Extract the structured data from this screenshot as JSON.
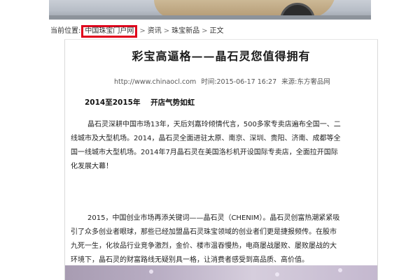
{
  "breadcrumb": {
    "prefix": "当前位置:",
    "items": [
      "中国珠宝门户网",
      "资讯",
      "珠宝新品",
      "正文"
    ],
    "separator": ">"
  },
  "article": {
    "title": "彩宝高逼格——晶石灵您值得拥有",
    "url": "http://www.chinaocl.com",
    "time_label": "时间:",
    "time": "2015-06-17 16:27",
    "source_label": "来源:",
    "source": "东方奢品网",
    "section_heading": "2014至2015年    开店气势如虹",
    "paragraph1_lines": [
      "晶石灵深耕中国市场13年，天后刘嘉玲倾情代言，500多家专卖店遍布全国一、二",
      "线城市及大型机场。2014，晶石灵全面进驻太原、南京、深圳、贵阳、济南、成都等全",
      "国一线城市大型机场。2014年7月晶石灵在美国洛杉机开设国际专卖店，全面拉开国际",
      "化发展大幕！"
    ],
    "paragraph2_lines": [
      "2015，中国创业市场再添关键词——晶石灵（CHENIM）。晶石灵创富热潮紧紧吸",
      "引了众多创业者眼球，那些已经加盟晶石灵珠宝领域的创业者们更是捷报频传。在股市",
      "九死一生，化妆品行业竞争激烈，金价、楼市温吞慢热，电商屡战屡败、屡败屡战的大",
      "环境下，晶石灵的财富路线无疑别具一格，让消费者感受到高品质、高价值。"
    ]
  },
  "colors": {
    "highlight_border": "#e0001b"
  }
}
